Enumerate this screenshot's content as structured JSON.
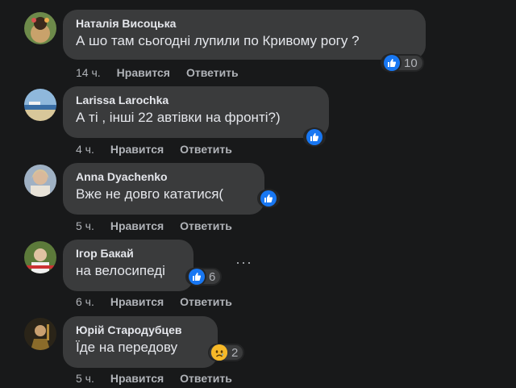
{
  "comments": [
    {
      "author": "Наталія Висоцька",
      "text": "А шо там сьогодні лупили по Кривому рогу ?",
      "reaction": "like",
      "reaction_count": "10",
      "time": "14 ч.",
      "like_label": "Нравится",
      "reply_label": "Ответить"
    },
    {
      "author": "Larissa Larochka",
      "text": "А ті , інші 22 автівки на фронті?)",
      "reaction": "like",
      "reaction_count": "",
      "time": "4 ч.",
      "like_label": "Нравится",
      "reply_label": "Ответить"
    },
    {
      "author": "Anna Dyachenko",
      "text": "Вже не довго кататися(",
      "reaction": "like",
      "reaction_count": "",
      "time": "5 ч.",
      "like_label": "Нравится",
      "reply_label": "Ответить"
    },
    {
      "author": "Ігор Бакай",
      "text": "на велосипеді",
      "reaction": "like",
      "reaction_count": "6",
      "time": "6 ч.",
      "like_label": "Нравится",
      "reply_label": "Ответить"
    },
    {
      "author": "Юрій Стародубцев",
      "text": "Їде на передову",
      "reaction": "sad",
      "reaction_count": "2",
      "time": "5 ч.",
      "like_label": "Нравится",
      "reply_label": "Ответить"
    }
  ],
  "more_options_icon": "three-dots-icon",
  "colors": {
    "background": "#18191a",
    "bubble": "#3a3b3c",
    "like_blue": "#1877f2",
    "sad_yellow": "#f7b928"
  }
}
